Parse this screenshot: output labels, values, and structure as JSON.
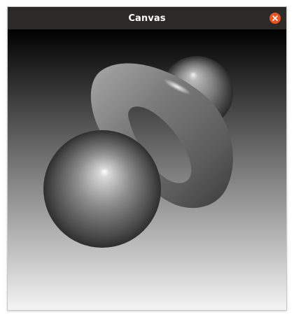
{
  "window": {
    "title": "Canvas",
    "close_icon": "close-icon"
  },
  "colors": {
    "titlebar": "#2c2a29",
    "close_button": "#e95420",
    "background_top": "#000000",
    "background_bottom": "#f4f4f4",
    "object_grey": "#8a8a8a"
  },
  "scene": {
    "objects": [
      "torus",
      "sphere",
      "sphere"
    ]
  }
}
